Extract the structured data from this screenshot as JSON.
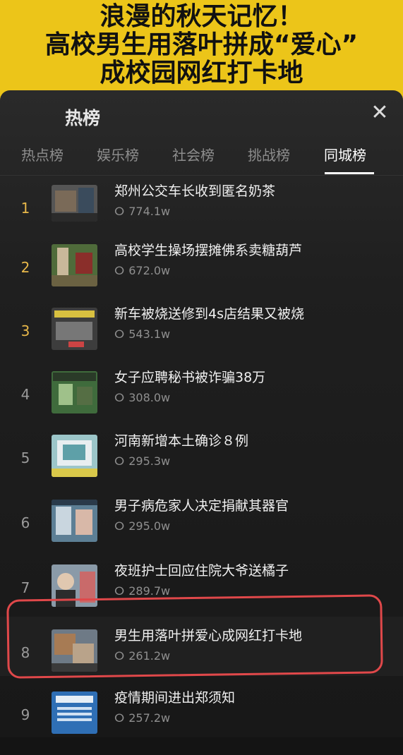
{
  "banner": {
    "line1": "浪漫的秋天记忆！",
    "line2": "高校男生用落叶拼成“爱心”",
    "line3": "成校园网红打卡地",
    "color": "#ecc519"
  },
  "panel": {
    "title": "热榜",
    "close_icon": "close-icon"
  },
  "tabs": [
    {
      "label": "热点榜"
    },
    {
      "label": "娱乐榜"
    },
    {
      "label": "社会榜"
    },
    {
      "label": "挑战榜"
    },
    {
      "label": "同城榜",
      "active": true
    }
  ],
  "items": [
    {
      "rank": "1",
      "title": "郑州公交车长收到匿名奶茶",
      "heat": "774.1w"
    },
    {
      "rank": "2",
      "title": "高校学生操场摆摊佛系卖糖葫芦",
      "heat": "672.0w"
    },
    {
      "rank": "3",
      "title": "新车被烧送修到4s店结果又被烧",
      "heat": "543.1w"
    },
    {
      "rank": "4",
      "title": "女子应聘秘书被诈骗38万",
      "heat": "308.0w"
    },
    {
      "rank": "5",
      "title": "河南新增本土确诊８例",
      "heat": "295.3w"
    },
    {
      "rank": "6",
      "title": "男子病危家人决定捐献其器官",
      "heat": "295.0w"
    },
    {
      "rank": "7",
      "title": "夜班护士回应住院大爷送橘子",
      "heat": "289.7w"
    },
    {
      "rank": "8",
      "title": "男生用落叶拼爱心成网红打卡地",
      "heat": "261.2w"
    },
    {
      "rank": "9",
      "title": "疫情期间进出郑须知",
      "heat": "257.2w"
    }
  ],
  "colors": {
    "top_rank": "#e8b84a",
    "highlight": "#e0484a"
  }
}
